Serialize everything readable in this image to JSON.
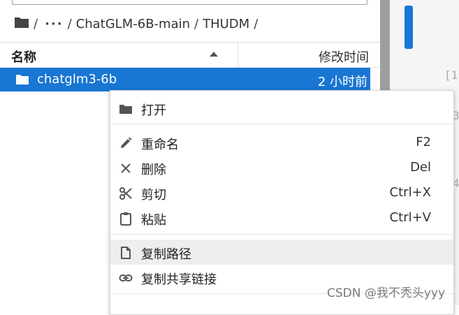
{
  "breadcrumb": {
    "sep": "/",
    "ellipsis": "···",
    "items": [
      "ChatGLM-6B-main",
      "THUDM"
    ]
  },
  "list": {
    "header_name": "名称",
    "header_modified": "修改时间",
    "rows": [
      {
        "name": "chatglm3-6b",
        "modified": "2 小时前",
        "selected": true
      }
    ]
  },
  "editor": {
    "line_numbers": [
      "[1",
      "3",
      "4"
    ]
  },
  "context_menu": {
    "items": [
      {
        "label": "打开",
        "shortcut": "",
        "icon": "folder-icon"
      },
      {
        "label": "重命名",
        "shortcut": "F2",
        "icon": "pencil-icon"
      },
      {
        "label": "删除",
        "shortcut": "Del",
        "icon": "close-icon"
      },
      {
        "label": "剪切",
        "shortcut": "Ctrl+X",
        "icon": "scissors-icon"
      },
      {
        "label": "粘贴",
        "shortcut": "Ctrl+V",
        "icon": "clipboard-icon"
      },
      {
        "label": "复制路径",
        "shortcut": "",
        "icon": "file-icon",
        "hovered": true
      },
      {
        "label": "复制共享链接",
        "shortcut": "",
        "icon": "link-icon"
      }
    ]
  },
  "watermark": "CSDN @我不秃头yyy",
  "colors": {
    "accent": "#1976d2",
    "gutter": "#9e9e9e",
    "hover": "#eeeeee"
  }
}
